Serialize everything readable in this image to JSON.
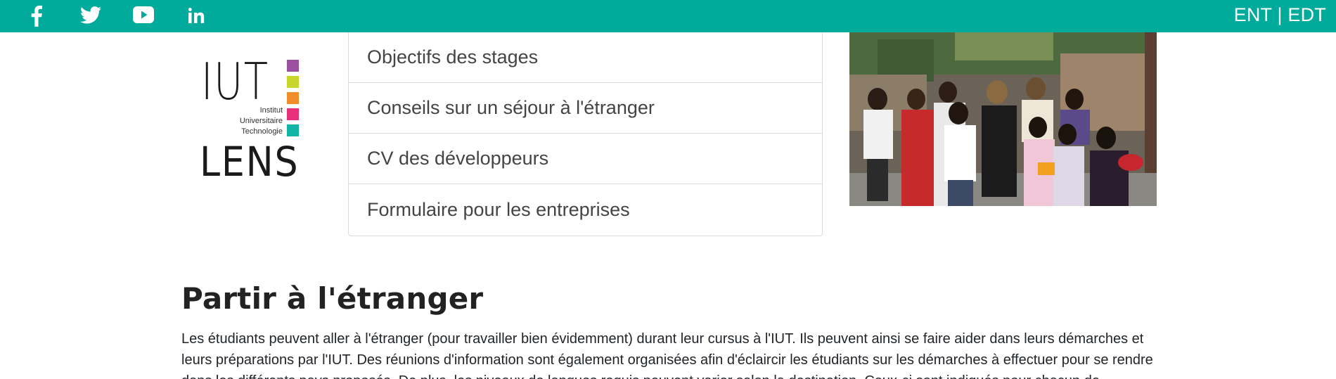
{
  "topbar": {
    "background": "#00ab9c",
    "social_icons": [
      "facebook-icon",
      "twitter-icon",
      "youtube-icon",
      "linkedin-icon"
    ],
    "links": {
      "ent": "ENT",
      "separator": " | ",
      "edt": "EDT"
    }
  },
  "logo": {
    "iut": "IUT",
    "lines": [
      "Institut",
      "Universitaire",
      "Technologie"
    ],
    "city": "LENS",
    "colors": [
      "#9b4f9e",
      "#c6d62a",
      "#f08c2a",
      "#e8307a",
      "#10b3a4"
    ]
  },
  "menu": {
    "items": [
      "Objectifs des stages",
      "Conseils sur un séjour à l'étranger",
      "CV des développeurs",
      "Formulaire pour les entreprises"
    ]
  },
  "photo": {
    "icon": "group-photo-image"
  },
  "main": {
    "title": "Partir à l'étranger",
    "paragraph": "Les étudiants peuvent aller à l'étranger (pour travailler bien évidemment) durant leur cursus à l'IUT. Ils peuvent ainsi se faire aider dans leurs démarches et leurs préparations par l'IUT. Des réunions d'information sont également organisées afin d'éclaircir les étudiants sur les démarches à effectuer pour se rendre dans les différents pays proposés. De plus, les niveaux de langues requis peuvent varier selon la destination. Ceux-ci sont indiqués pour chacun de"
  }
}
